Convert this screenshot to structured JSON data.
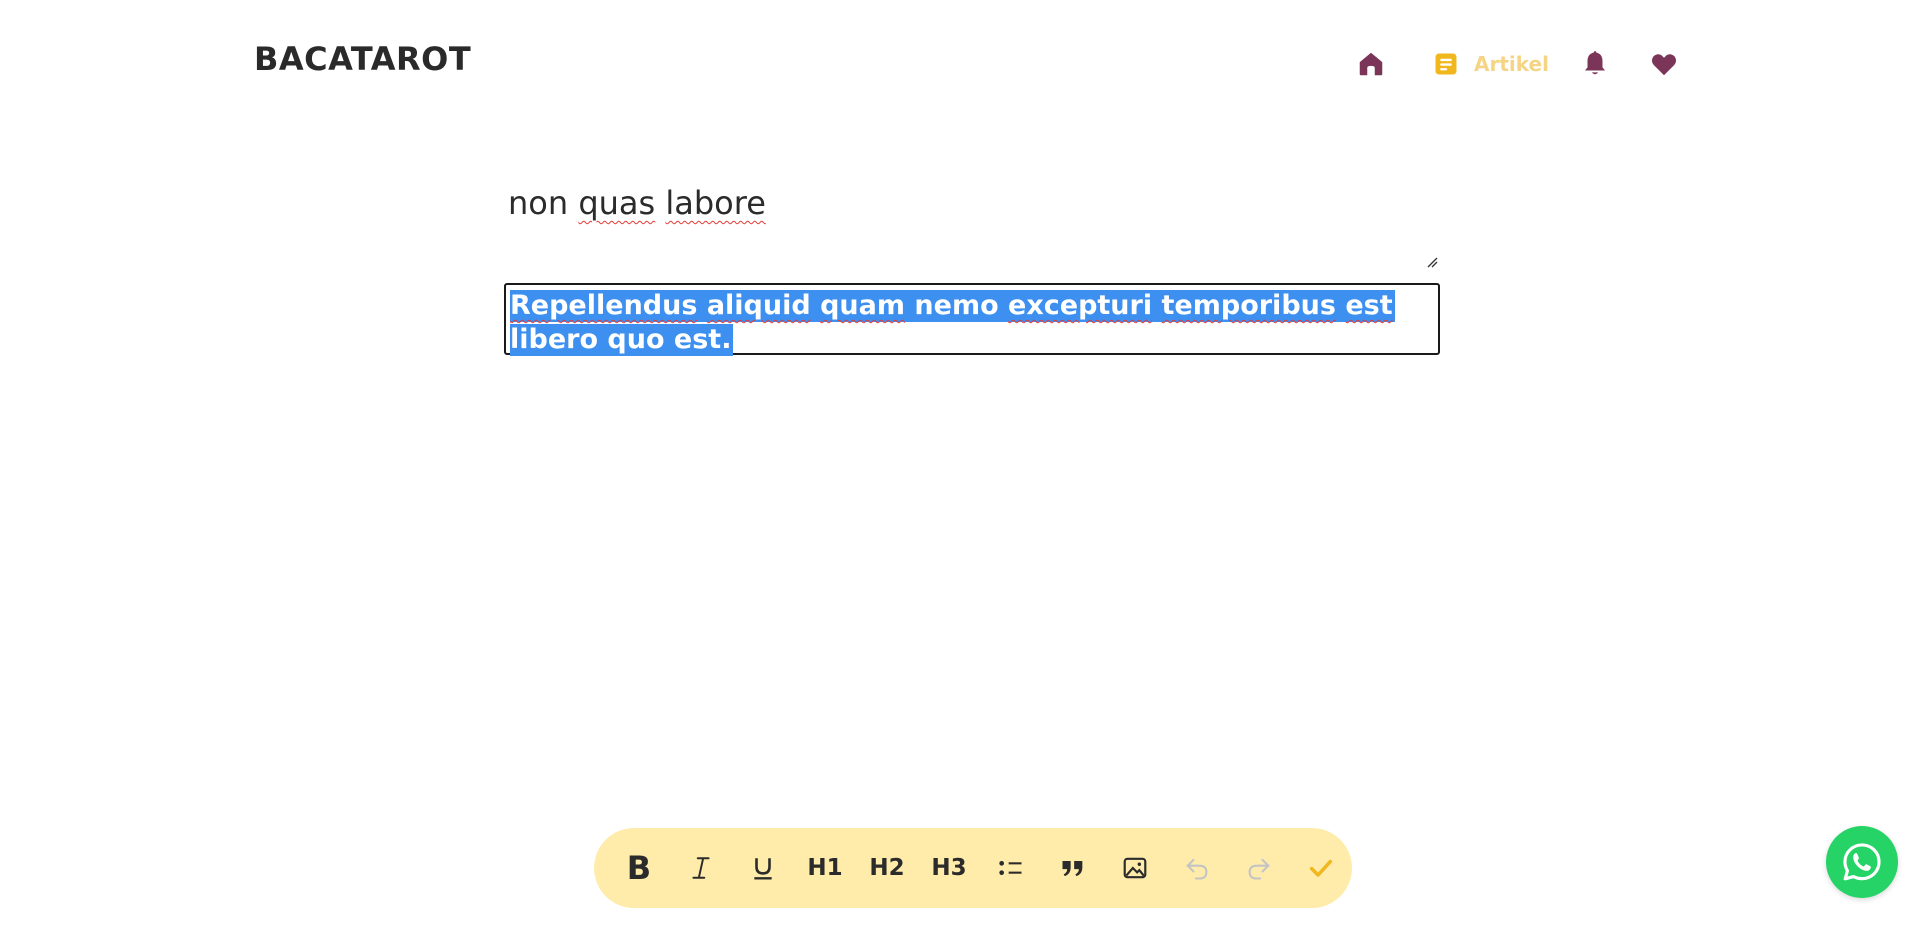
{
  "header": {
    "logo": "BACATAROT",
    "nav": {
      "home_icon": "home-icon",
      "artikel_icon": "document-icon",
      "artikel_label": "Artikel",
      "notifications_icon": "bell-icon",
      "favorites_icon": "heart-icon"
    },
    "colors": {
      "nav_icon": "#7a3559",
      "active": "#f0b81e",
      "active_label": "#f5d585"
    }
  },
  "editor": {
    "title_words": [
      "non",
      "quas",
      "labore"
    ],
    "content_words": {
      "w1": "Repellendus",
      "w2": "aliquid",
      "w3": "quam",
      "w4": "nemo",
      "w5": "excepturi",
      "w6": "temporibus",
      "w7": "est",
      "w8": "libero quo est."
    },
    "selection_color": "#3d8ff0"
  },
  "toolbar": {
    "bold": "B",
    "italic": "I",
    "underline": "U",
    "h1": "H1",
    "h2": "H2",
    "h3": "H3",
    "list_icon": "bullet-list-icon",
    "quote_icon": "quote-icon",
    "image_icon": "image-icon",
    "undo_icon": "undo-icon",
    "redo_icon": "redo-icon",
    "save_icon": "check-icon",
    "background": "#ffecaa",
    "check_color": "#f0b81e"
  },
  "whatsapp": {
    "icon": "whatsapp-icon",
    "color": "#25d366"
  }
}
